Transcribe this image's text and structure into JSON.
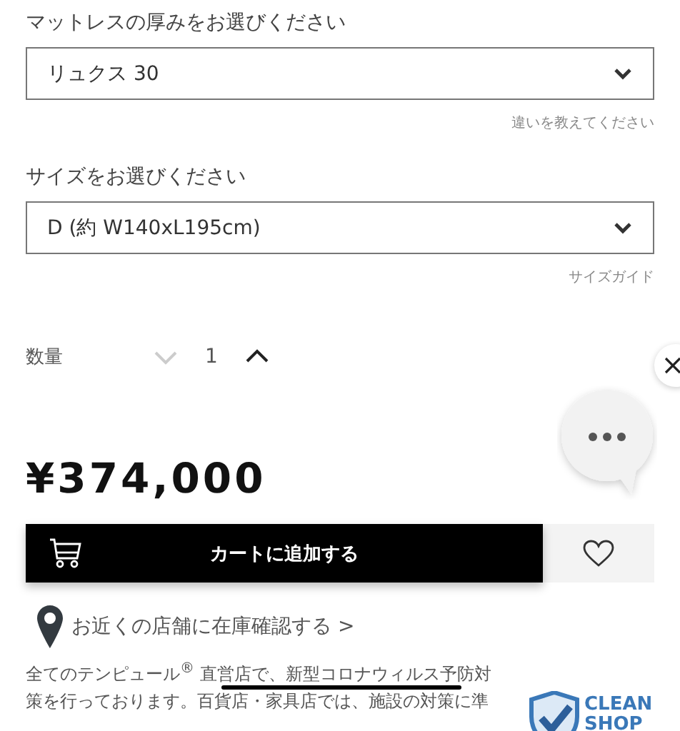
{
  "thickness": {
    "label": "マットレスの厚みをお選びください",
    "value": "リュクス 30",
    "hint": "違いを教えてください"
  },
  "size": {
    "label": "サイズをお選びください",
    "value": "D (約 W140xL195cm)",
    "hint": "サイズガイド"
  },
  "quantity": {
    "label": "数量",
    "value": "1",
    "decrement_disabled": true,
    "increment_disabled": false
  },
  "price": "¥374,000",
  "cart_button": "カートに追加する",
  "favorite": {
    "selected": false
  },
  "store_link": "お近くの店舗に在庫確認する >",
  "notice_lines": [
    "全てのテンピュール$^{®}$ 直営店で、新型コロナウィルス予防対",
    "策を行っております。百貨店・家具店では、施設の対策に準"
  ],
  "clean_shop": [
    "CLEAN",
    "SHOP"
  ]
}
